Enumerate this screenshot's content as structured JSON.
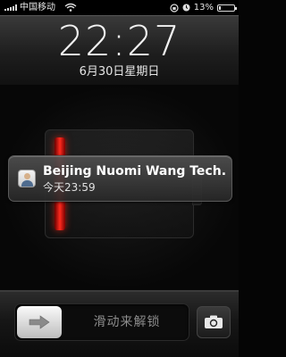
{
  "status_bar": {
    "carrier": "中国移动",
    "battery_percent": "13%",
    "battery_level": 0.13
  },
  "lock_screen": {
    "time": "22:27",
    "date": "6月30日星期日"
  },
  "notification": {
    "title": "Beijing Nuomi Wang Tech...",
    "time": "今天23:59",
    "icon": "app-avatar-icon"
  },
  "slider": {
    "label": "滑动来解锁",
    "knob_icon": "arrow-right-icon"
  },
  "camera": {
    "icon": "camera-icon"
  },
  "colors": {
    "battery_red": "#ff2b1f",
    "text_primary": "#f2f2f2"
  }
}
